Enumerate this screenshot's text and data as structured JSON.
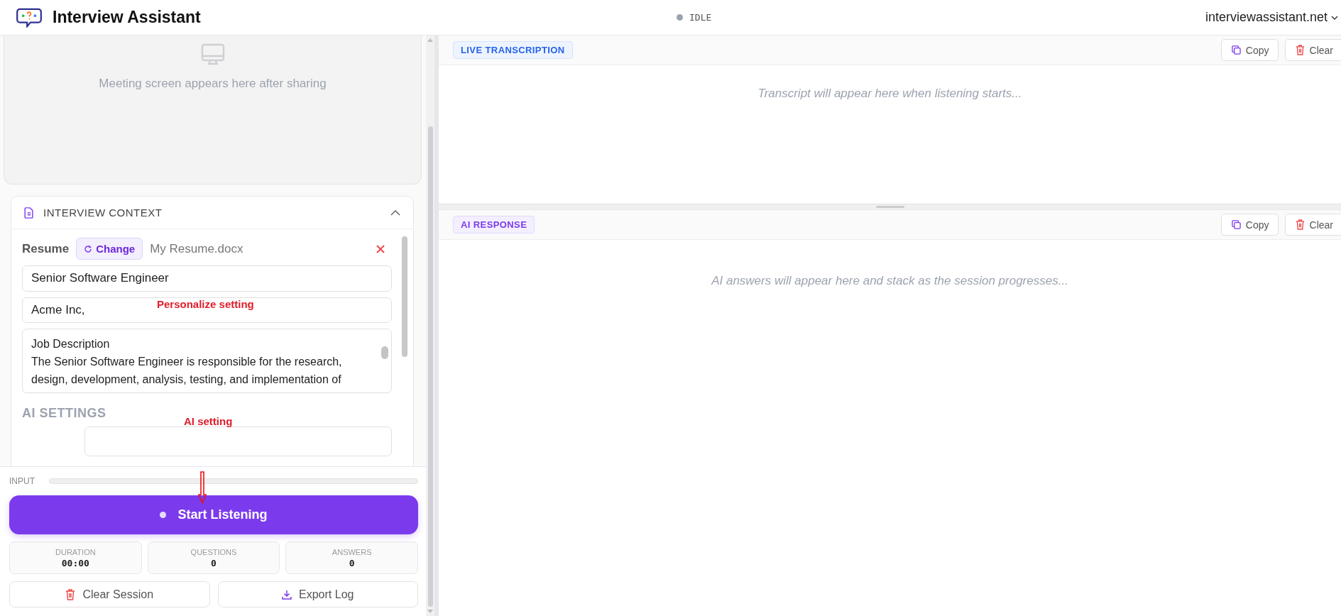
{
  "app": {
    "title": "Interview Assistant"
  },
  "status": {
    "label": "IDLE"
  },
  "account": {
    "domain": "interviewassistant.net"
  },
  "screen_preview": {
    "message": "Meeting screen appears here after sharing"
  },
  "interview_context": {
    "title": "INTERVIEW CONTEXT",
    "expanded": true,
    "resume_label": "Resume",
    "change_button": "Change",
    "resume_file": "My Resume.docx",
    "job_title": "Senior Software Engineer",
    "company": "Acme Inc,",
    "job_description": "Job Description\nThe Senior Software Engineer is responsible for the research, design, development, analysis, testing, and implementation of",
    "ai_settings_title": "AI SETTINGS"
  },
  "annotations": [
    {
      "text": "Personalize setting"
    },
    {
      "text": "AI setting"
    }
  ],
  "input_meter": {
    "label": "INPUT",
    "level": 0
  },
  "listen_button": "Start Listening",
  "stats": [
    {
      "label": "DURATION",
      "value": "00:00"
    },
    {
      "label": "QUESTIONS",
      "value": "0"
    },
    {
      "label": "ANSWERS",
      "value": "0"
    }
  ],
  "actions": [
    {
      "kind": "clear",
      "label": "Clear Session"
    },
    {
      "kind": "export",
      "label": "Export Log"
    }
  ],
  "panels": [
    {
      "kind": "transcription",
      "title": "LIVE TRANSCRIPTION",
      "placeholder": "Transcript will appear here when listening starts...",
      "buttons": [
        {
          "kind": "copy",
          "label": "Copy"
        },
        {
          "kind": "clear",
          "label": "Clear"
        }
      ]
    },
    {
      "kind": "response",
      "title": "AI RESPONSE",
      "placeholder": "AI answers will appear here and stack as the session progresses...",
      "buttons": [
        {
          "kind": "copy",
          "label": "Copy"
        },
        {
          "kind": "clear",
          "label": "Clear"
        }
      ]
    }
  ]
}
